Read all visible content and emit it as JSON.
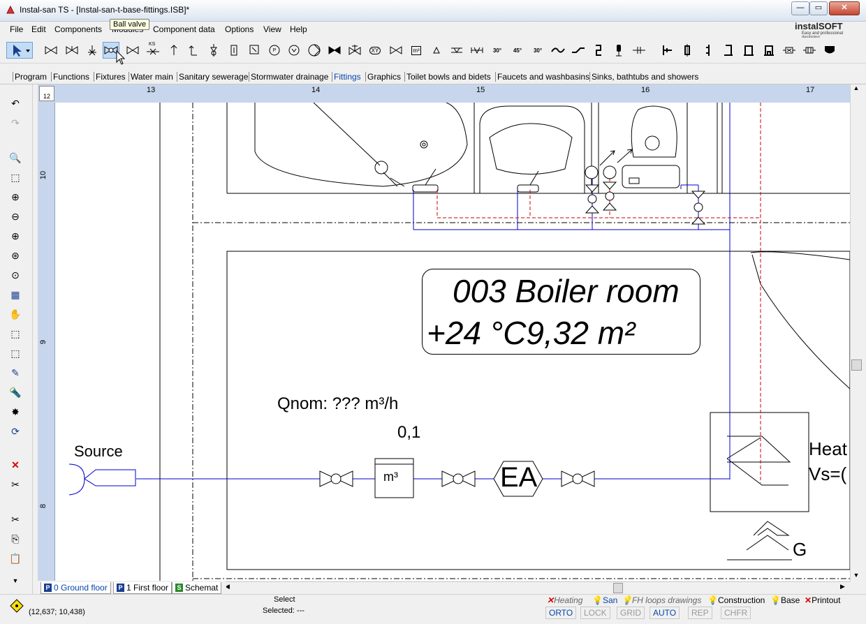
{
  "window": {
    "title": "Instal-san TS - [Instal-san-t-base-fittings.ISB]*",
    "btn_minimize": "—",
    "btn_maximize": "▭",
    "btn_close": "✕"
  },
  "menu": [
    "File",
    "Edit",
    "Components",
    "Modules",
    "Component data",
    "Options",
    "View",
    "Help"
  ],
  "tooltip": "Ball valve",
  "logo": {
    "brand": "instalSOFT",
    "tagline": "Easy and professional designing"
  },
  "toolbar_labels": {
    "ks": "KS",
    "sw30a": "30°",
    "sw45": "45°",
    "sw30b": "30°",
    "xy": "XY",
    "m3": "m³",
    "p": "P",
    "v": "V"
  },
  "tabs": [
    "Program",
    "Functions",
    "Fixtures",
    "Water main",
    "Sanitary sewerage",
    "Stormwater drainage",
    "Fittings",
    "Graphics",
    "Toilet bowls and bidets",
    "Faucets and washbasins",
    "Sinks, bathtubs and showers"
  ],
  "active_tab": "Fittings",
  "ruler": {
    "corner": "12",
    "h": [
      "13",
      "14",
      "15",
      "16",
      "17"
    ],
    "v": [
      "10",
      "9",
      "8"
    ]
  },
  "drawing": {
    "room_name": "003 Boiler room",
    "room_info": "+24 °C9,32 m²",
    "qnom": "Qnom: ??? m³/h",
    "qvalue": "0,1",
    "source": "Source",
    "meter": "m³",
    "ea": "EA",
    "heater_1": "Heat",
    "heater_2": "Vs=(",
    "g": "G"
  },
  "floor_tabs": [
    {
      "badge": "P",
      "label": "0 Ground floor"
    },
    {
      "badge": "P",
      "label": "1 First floor"
    },
    {
      "badge": "S",
      "label": "Schemat"
    }
  ],
  "status": {
    "tool": "Select",
    "selected": "Selected: ---",
    "coords": "(12,637; 10,438)"
  },
  "layers": [
    "Heating",
    "San",
    "FH loops drawings",
    "Construction",
    "Base",
    "Printout"
  ],
  "modes": [
    "ORTO",
    "LOCK",
    "GRID",
    "AUTO",
    "REP",
    "CHFR"
  ],
  "colors": {
    "pipe_blue": "#0000cc",
    "pipe_red": "#cc0000",
    "ruler": "#c7d6ec",
    "active_tab": "#0645ad"
  }
}
